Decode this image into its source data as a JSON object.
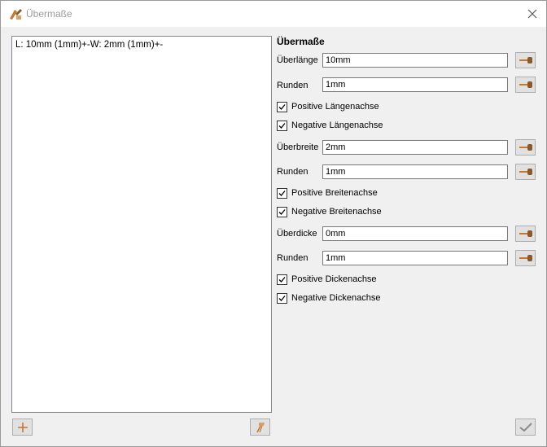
{
  "window": {
    "title": "Übermaße"
  },
  "list": {
    "items": [
      "L: 10mm (1mm)+-W: 2mm (1mm)+-"
    ]
  },
  "panel": {
    "title": "Übermaße",
    "length_label": "Überlänge",
    "length_value": "10mm",
    "length_round_label": "Runden",
    "length_round_value": "1mm",
    "pos_length": "Positive Längenachse",
    "neg_length": "Negative Längenachse",
    "width_label": "Überbreite",
    "width_value": "2mm",
    "width_round_label": "Runden",
    "width_round_value": "1mm",
    "pos_width": "Positive Breitenachse",
    "neg_width": "Negative Breitenachse",
    "thickness_label": "Überdicke",
    "thickness_value": "0mm",
    "thickness_round_label": "Runden",
    "thickness_round_value": "1mm",
    "pos_thickness": "Positive Dickenachse",
    "neg_thickness": "Negative Dickenachse"
  },
  "checks": {
    "all_checked": true
  },
  "colors": {
    "accent": "#c8782a",
    "icon_brown": "#8a5a2b"
  }
}
